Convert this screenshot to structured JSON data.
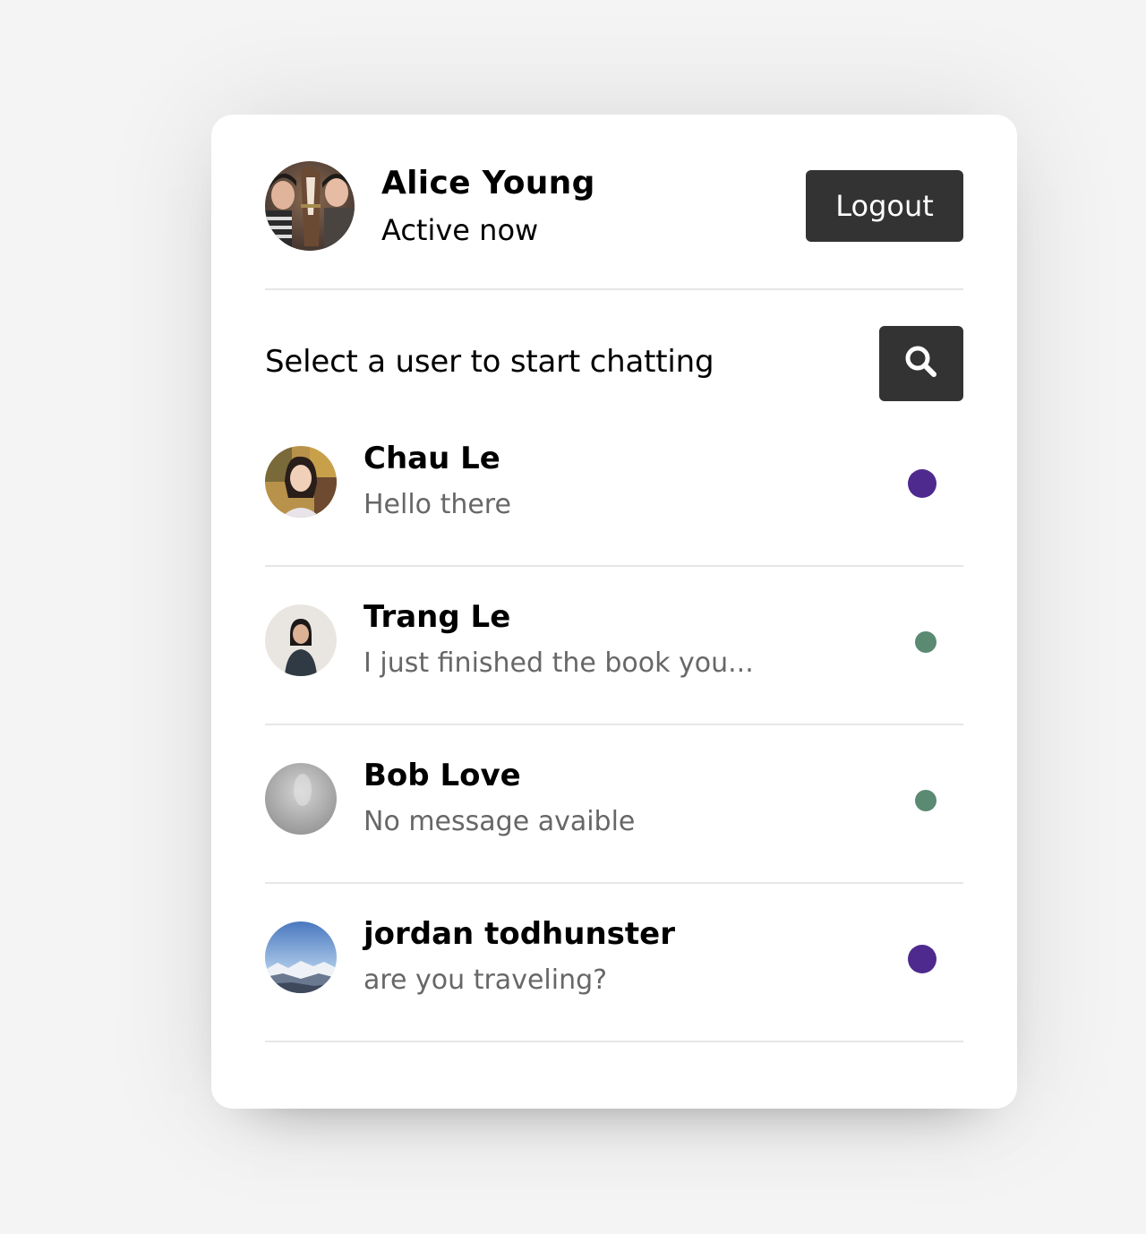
{
  "current_user": {
    "name": "Alice Young",
    "status": "Active now",
    "avatar_icon": "user-photo"
  },
  "logout_label": "Logout",
  "search": {
    "prompt": "Select a user to start chatting",
    "icon": "search-icon"
  },
  "users": [
    {
      "name": "Chau Le",
      "last_message": "Hello there",
      "status_color": "#4e2a8e",
      "status": "unread"
    },
    {
      "name": "Trang Le",
      "last_message": "I just finished the book you...",
      "status_color": "#5a8a72",
      "status": "online"
    },
    {
      "name": "Bob Love",
      "last_message": "No message avaible",
      "status_color": "#5a8a72",
      "status": "online"
    },
    {
      "name": "jordan todhunster",
      "last_message": "are you traveling?",
      "status_color": "#4e2a8e",
      "status": "unread"
    }
  ],
  "colors": {
    "button_bg": "#333333",
    "divider": "#e6e6e6",
    "secondary_text": "#676767",
    "unread_dot": "#4e2a8e",
    "online_dot": "#5a8a72"
  }
}
